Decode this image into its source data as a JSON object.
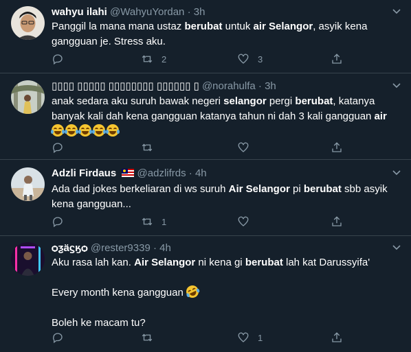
{
  "tweets": [
    {
      "name": "wahyu ilahi",
      "handle": "@WahyuYordan",
      "time": "3h",
      "text_parts": [
        "Panggil la mana mana ustaz ",
        "berubat",
        " untuk ",
        "air Selangor",
        ", asyik kena gangguan je. Stress aku."
      ],
      "reply_count": "",
      "retweet_count": "2",
      "like_count": "3"
    },
    {
      "name": "▯▯▯▯ ▯▯▯▯▯ ▯▯▯▯▯▯▯▯ ▯▯▯▯▯▯ ▯",
      "handle": "@norahulfa",
      "time": "3h",
      "text_parts": [
        "anak sedara aku suruh bawak negeri ",
        "selangor",
        " pergi ",
        "berubat",
        ", katanya banyak kali dah kena gangguan katanya tahun ni dah 3 kali gangguan ",
        "air"
      ],
      "emoji_count": 5,
      "reply_count": "",
      "retweet_count": "",
      "like_count": ""
    },
    {
      "name": "Adzli Firdaus",
      "flag": "malaysia-flag",
      "handle": "@adzlifrds",
      "time": "4h",
      "text_parts": [
        "Ada dad jokes berkeliaran di ws suruh ",
        "Air Selangor",
        " pi ",
        "berubat",
        " sbb asyik kena gangguan..."
      ],
      "reply_count": "",
      "retweet_count": "1",
      "like_count": ""
    },
    {
      "name": "ѻƺӓϛӄѻ",
      "handle": "@rester9339",
      "time": "4h",
      "text_parts": [
        "Aku rasa lah kan. ",
        "Air Selangor",
        " ni kena gi ",
        "berubat",
        " lah kat Darussyifa'"
      ],
      "line2": "Every month kena gangguan",
      "line3": "Boleh ke macam tu?",
      "reply_count": "",
      "retweet_count": "",
      "like_count": "1"
    }
  ],
  "icons": {
    "reply": "reply-icon",
    "retweet": "retweet-icon",
    "like": "like-icon",
    "share": "share-icon",
    "caret": "chevron-down-icon"
  },
  "colors": {
    "background": "#15202b",
    "muted": "#8899a6",
    "divider": "#38444d"
  }
}
